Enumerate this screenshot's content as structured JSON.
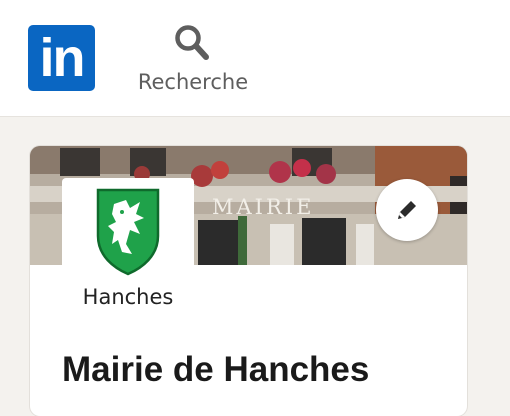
{
  "header": {
    "logo_text": "in",
    "nav": {
      "search_label": "Recherche",
      "search_icon": "search-icon"
    }
  },
  "profile": {
    "logo_caption": "Hanches",
    "cover_sign": "MAIRIE",
    "name": "Mairie de Hanches",
    "edit_icon": "pencil-icon"
  },
  "colors": {
    "brand": "#0a66c2",
    "crest_green": "#1fa24a",
    "background": "#f4f2ee"
  }
}
